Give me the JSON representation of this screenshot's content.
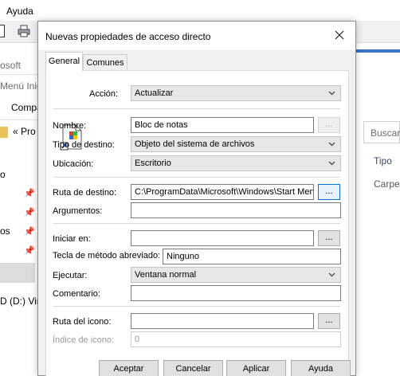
{
  "background": {
    "menu_ayuda": "Ayuda",
    "text_ms": "osoft",
    "text_menu": "Menú Inic",
    "text_comp": "Compa",
    "nav_text": "«  Pro",
    "item_o": "o",
    "item_os": "os",
    "drive": "D (D:) Vir",
    "search_placeholder": "Buscar",
    "col_tipo": "Tipo",
    "cell_carpe": "Carpet"
  },
  "dialog": {
    "title": "Nuevas propiedades de acceso directo",
    "tabs": [
      "General",
      "Comunes"
    ],
    "accion_label": "Acción:",
    "accion_value": "Actualizar",
    "nombre_label": "Nombre:",
    "nombre_value": "Bloc de notas",
    "tipo_label": "Tipo de destino:",
    "tipo_value": "Objeto del sistema de archivos",
    "ubicacion_label": "Ubicación:",
    "ubicacion_value": "Escritorio",
    "ruta_label": "Ruta de destino:",
    "ruta_value": "C:\\ProgramData\\Microsoft\\Windows\\Start Menu",
    "argumentos_label": "Argumentos:",
    "argumentos_value": "",
    "iniciar_label": "Iniciar en:",
    "iniciar_value": "",
    "tecla_label": "Tecla de método abreviado:",
    "tecla_value": "Ninguno",
    "ejecutar_label": "Ejecutar:",
    "ejecutar_value": "Ventana normal",
    "comentario_label": "Comentario:",
    "comentario_value": "",
    "ruta_icono_label": "Ruta del icono:",
    "ruta_icono_value": "",
    "indice_label": "Índice de icono:",
    "indice_value": "0",
    "browse_label": "...",
    "buttons": {
      "aceptar": "Aceptar",
      "cancelar": "Cancelar",
      "aplicar": "Aplicar",
      "ayuda": "Ayuda"
    }
  }
}
